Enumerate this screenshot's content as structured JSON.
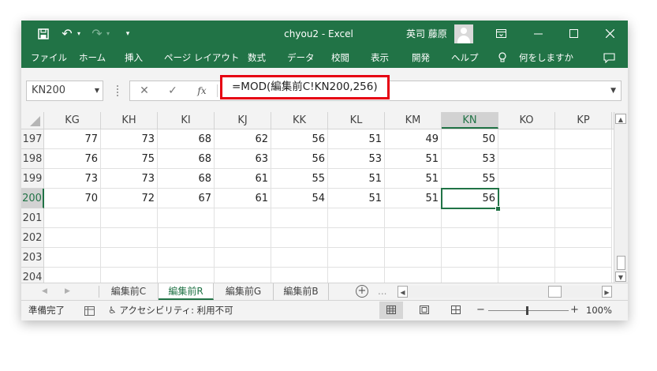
{
  "titlebar": {
    "title": "chyou2  -  Excel",
    "user_name": "英司 藤原",
    "save_icon": "save-icon",
    "undo_icon": "undo-icon",
    "redo_icon": "redo-icon",
    "qat_icon": "customize-qat-icon",
    "ribbon_display_icon": "ribbon-display-options-icon",
    "minimize_icon": "minimize-icon",
    "maximize_icon": "maximize-icon",
    "close_icon": "close-icon"
  },
  "menu": {
    "items": [
      "ファイル",
      "ホーム",
      "挿入",
      "ページ レイアウト",
      "数式",
      "データ",
      "校閲",
      "表示",
      "開発",
      "ヘルプ"
    ],
    "tell_me": "何をしますか",
    "lightbulb_icon": "lightbulb-icon",
    "comments_icon": "comments-icon"
  },
  "formula_bar": {
    "name_box": "KN200",
    "cancel_symbol": "✕",
    "enter_symbol": "✓",
    "fx_symbol": "fx",
    "formula": "=MOD(編集前C!KN200,256)"
  },
  "grid": {
    "columns": [
      "KG",
      "KH",
      "KI",
      "KJ",
      "KK",
      "KL",
      "KM",
      "KN",
      "KO",
      "KP"
    ],
    "selected_column": "KN",
    "rows": [
      {
        "label": "197",
        "cells": [
          "77",
          "73",
          "68",
          "62",
          "56",
          "51",
          "49",
          "50",
          "",
          ""
        ]
      },
      {
        "label": "198",
        "cells": [
          "76",
          "75",
          "68",
          "63",
          "56",
          "53",
          "51",
          "53",
          "",
          ""
        ]
      },
      {
        "label": "199",
        "cells": [
          "73",
          "73",
          "68",
          "61",
          "55",
          "51",
          "51",
          "55",
          "",
          ""
        ]
      },
      {
        "label": "200",
        "cells": [
          "70",
          "72",
          "67",
          "61",
          "54",
          "51",
          "51",
          "56",
          "",
          ""
        ]
      },
      {
        "label": "201",
        "cells": [
          "",
          "",
          "",
          "",
          "",
          "",
          "",
          "",
          "",
          ""
        ]
      },
      {
        "label": "202",
        "cells": [
          "",
          "",
          "",
          "",
          "",
          "",
          "",
          "",
          "",
          ""
        ]
      },
      {
        "label": "203",
        "cells": [
          "",
          "",
          "",
          "",
          "",
          "",
          "",
          "",
          "",
          ""
        ]
      },
      {
        "label": "204",
        "cells": [
          "",
          "",
          "",
          "",
          "",
          "",
          "",
          "",
          "",
          ""
        ]
      }
    ],
    "selected_row": "200"
  },
  "sheets": {
    "tabs": [
      "編集前C",
      "編集前R",
      "編集前G",
      "編集前B"
    ],
    "active": "編集前R",
    "more": "..."
  },
  "status": {
    "ready": "準備完了",
    "accessibility": "アクセシビリティ: 利用不可",
    "zoom": "100%",
    "zoom_minus": "−",
    "zoom_plus": "+"
  },
  "colors": {
    "excel_green": "#217346",
    "highlight_red": "#e60012"
  }
}
